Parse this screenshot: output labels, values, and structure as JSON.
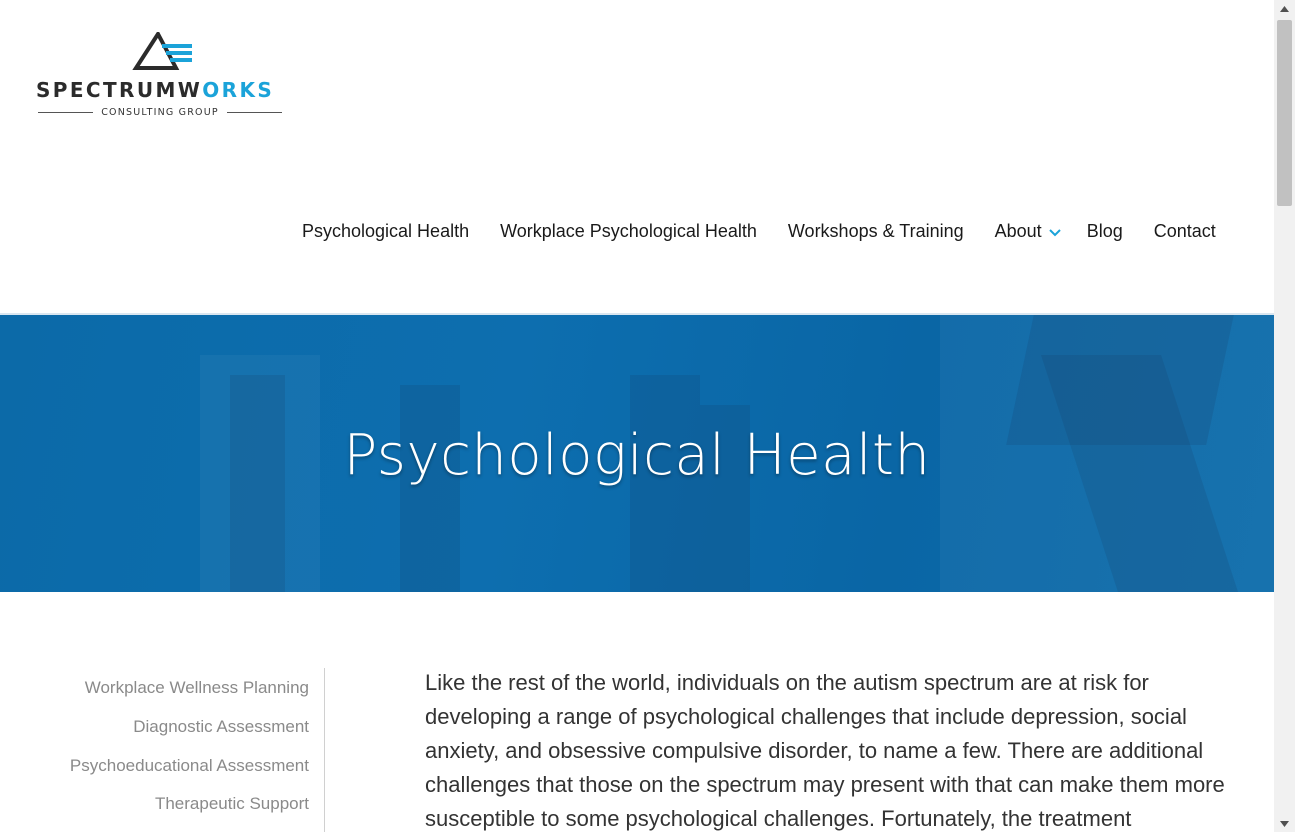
{
  "brand": {
    "word_dark": "SPECTRUMW",
    "word_o": "O",
    "word_blue_tail": "RKS",
    "subtitle": "CONSULTING GROUP",
    "accent_color": "#1ba3d9"
  },
  "nav": {
    "items": [
      {
        "label": "Psychological Health"
      },
      {
        "label": "Workplace Psychological Health"
      },
      {
        "label": "Workshops & Training"
      },
      {
        "label": "About"
      },
      {
        "label": "Blog"
      },
      {
        "label": "Contact"
      }
    ],
    "about_dropdown_icon": "chevron-down-icon"
  },
  "hero": {
    "title": "Psychological Health",
    "background_color": "#0c6aa8"
  },
  "sidebar": {
    "items": [
      {
        "label": "Workplace Wellness Planning"
      },
      {
        "label": "Diagnostic Assessment"
      },
      {
        "label": "Psychoeducational Assessment"
      },
      {
        "label": "Therapeutic Support"
      }
    ]
  },
  "main": {
    "paragraph": "Like the rest of the world, individuals on the autism spectrum are at risk for developing a range of psychological challenges that include depression, social anxiety, and obsessive compulsive disorder, to name a few. There are additional challenges that those on the spectrum may present with that can make them more susceptible to some psychological challenges. Fortunately, the treatment"
  }
}
